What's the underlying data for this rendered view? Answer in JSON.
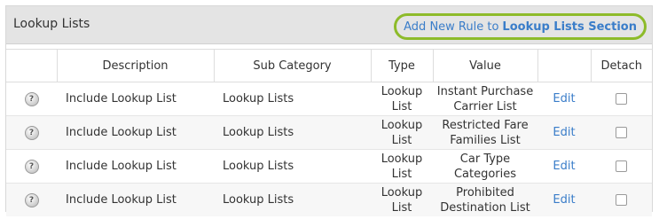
{
  "panel": {
    "title": "Lookup Lists",
    "add_rule": {
      "prefix": "Add New Rule to",
      "bold": "Lookup Lists Section"
    }
  },
  "table": {
    "columns": [
      "",
      "Description",
      "Sub Category",
      "Type",
      "Value",
      "",
      "Detach"
    ],
    "rows": [
      {
        "description": "Include Lookup List",
        "sub_category": "Lookup Lists",
        "type": "Lookup List",
        "value": "Instant Purchase Carrier List",
        "action": "Edit",
        "detach": false
      },
      {
        "description": "Include Lookup List",
        "sub_category": "Lookup Lists",
        "type": "Lookup List",
        "value": "Restricted Fare Families List",
        "action": "Edit",
        "detach": false
      },
      {
        "description": "Include Lookup List",
        "sub_category": "Lookup Lists",
        "type": "Lookup List",
        "value": "Car Type Categories",
        "action": "Edit",
        "detach": false
      },
      {
        "description": "Include Lookup List",
        "sub_category": "Lookup Lists",
        "type": "Lookup List",
        "value": "Prohibited Destination List",
        "action": "Edit",
        "detach": false
      }
    ]
  },
  "icons": {
    "help": "help-icon"
  },
  "colors": {
    "link": "#3a7dc9",
    "highlight_ring": "#8dbb2a",
    "header_bg": "#e4e4e4"
  }
}
